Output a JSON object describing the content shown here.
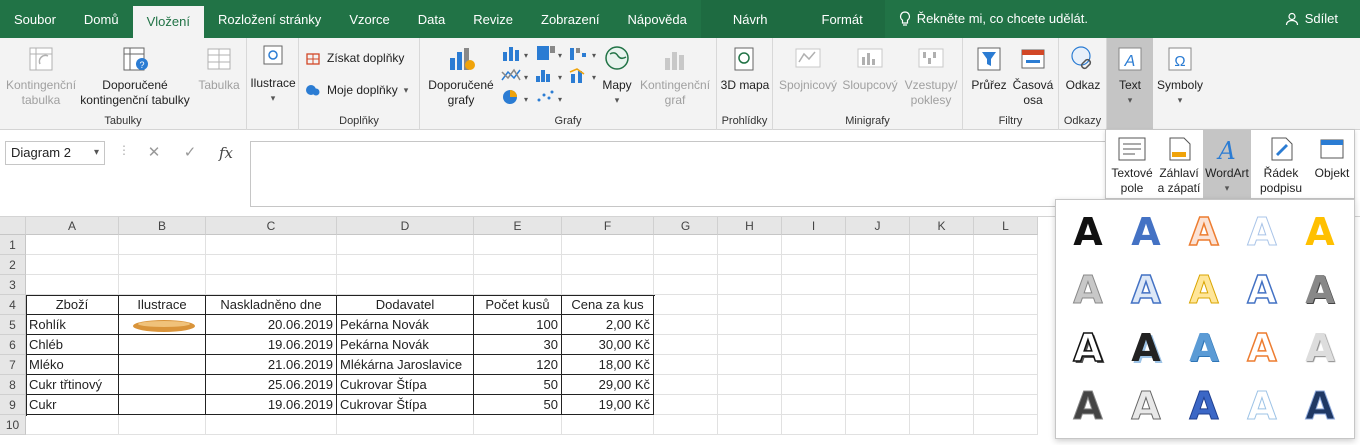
{
  "tabs": [
    "Soubor",
    "Domů",
    "Vložení",
    "Rozložení stránky",
    "Vzorce",
    "Data",
    "Revize",
    "Zobrazení",
    "Nápověda"
  ],
  "context_tabs": [
    "Návrh",
    "Formát"
  ],
  "tell_me": "Řekněte mi, co chcete udělát.",
  "share": "Sdílet",
  "ribbon": {
    "tabulky": {
      "label": "Tabulky",
      "pivot": "Kontingenční tabulka",
      "rec_pivot": "Doporučené kontingenční tabulky",
      "table": "Tabulka"
    },
    "ilustrace": {
      "label": "Ilustrace"
    },
    "doplnky": {
      "label": "Doplňky",
      "get": "Získat doplňky",
      "my": "Moje doplňky"
    },
    "grafy": {
      "label": "Grafy",
      "rec": "Doporučené grafy",
      "maps": "Mapy",
      "pivot_chart": "Kontingenční graf"
    },
    "prohlidky": {
      "label": "Prohlídky",
      "map3d": "3D mapa"
    },
    "minigrafy": {
      "label": "Minigrafy",
      "line": "Spojnicový",
      "column": "Sloupcový",
      "winloss": "Vzestupy/ poklesy"
    },
    "filtry": {
      "label": "Filtry",
      "slicer": "Průřez",
      "timeline": "Časová osa"
    },
    "odkazy": {
      "label": "Odkazy",
      "link": "Odkaz"
    },
    "text": {
      "label": "Text"
    },
    "symboly": {
      "label": "Symboly"
    }
  },
  "text_panel": {
    "textbox": "Textové pole",
    "header": "Záhlaví a zápatí",
    "wordart": "WordArt",
    "sigline": "Řádek podpisu",
    "object": "Objekt"
  },
  "namebox": "Diagram 2",
  "columns": [
    "A",
    "B",
    "C",
    "D",
    "E",
    "F",
    "G",
    "H",
    "I",
    "J",
    "K",
    "L"
  ],
  "rows": [
    "1",
    "2",
    "3",
    "4",
    "5",
    "6",
    "7",
    "8",
    "9",
    "10"
  ],
  "table": {
    "headers": [
      "Zboží",
      "Ilustrace",
      "Naskladněno dne",
      "Dodavatel",
      "Počet kusů",
      "Cena za kus"
    ],
    "rows": [
      [
        "Rohlík",
        "",
        "20.06.2019",
        "Pekárna Novák",
        "100",
        "2,00 Kč"
      ],
      [
        "Chléb",
        "",
        "19.06.2019",
        "Pekárna Novák",
        "30",
        "30,00 Kč"
      ],
      [
        "Mléko",
        "",
        "21.06.2019",
        "Mlékárna Jaroslavice",
        "120",
        "18,00 Kč"
      ],
      [
        "Cukr třtinový",
        "",
        "25.06.2019",
        "Cukrovar Štípa",
        "50",
        "29,00 Kč"
      ],
      [
        "Cukr",
        "",
        "19.06.2019",
        "Cukrovar Štípa",
        "50",
        "19,00 Kč"
      ]
    ]
  },
  "wordart_glyph": "A",
  "colors": {
    "accent": "#217346",
    "wordart_blue": "#4472c4",
    "wordart_orange": "#ed7d31",
    "wordart_gold": "#ffc000"
  }
}
